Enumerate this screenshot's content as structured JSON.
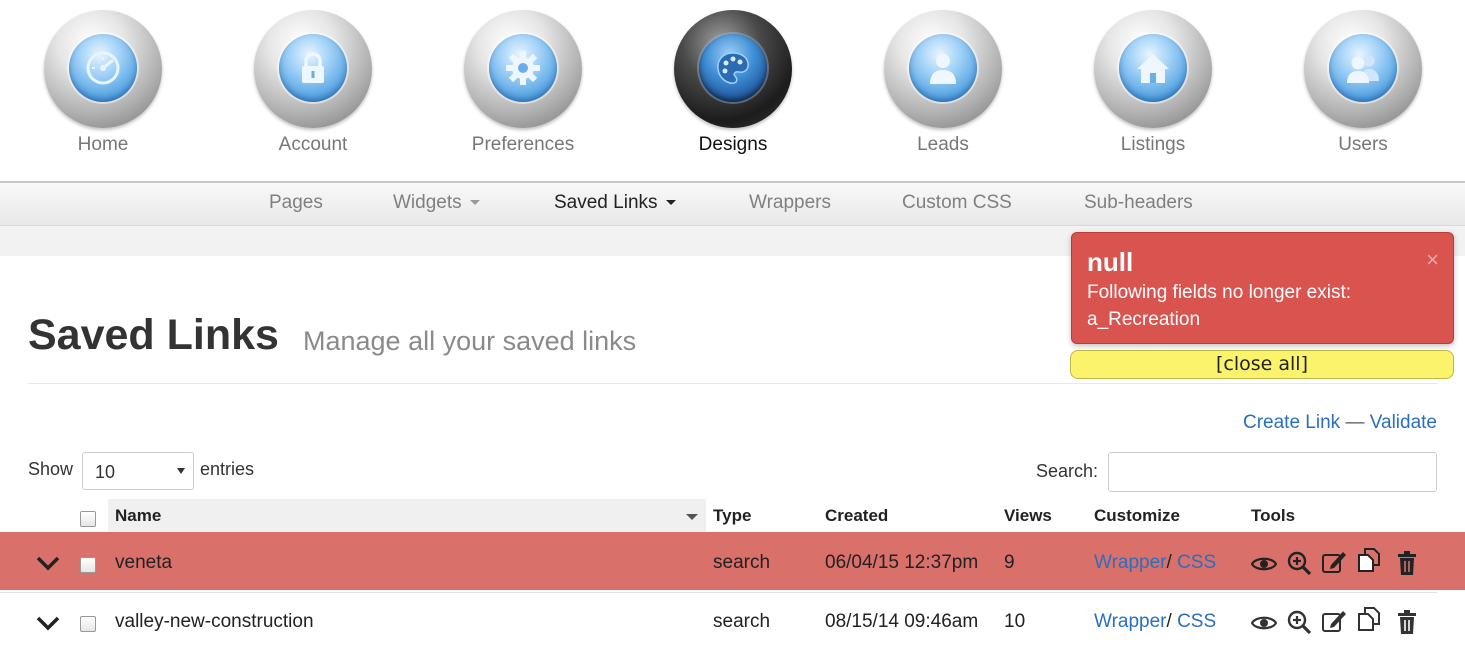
{
  "top_nav": {
    "items": [
      {
        "label": "Home",
        "icon": "dashboard-icon"
      },
      {
        "label": "Account",
        "icon": "lock-icon"
      },
      {
        "label": "Preferences",
        "icon": "gear-icon"
      },
      {
        "label": "Designs",
        "icon": "palette-icon",
        "active": true
      },
      {
        "label": "Leads",
        "icon": "person-icon"
      },
      {
        "label": "Listings",
        "icon": "house-icon"
      },
      {
        "label": "Users",
        "icon": "users-icon"
      }
    ]
  },
  "sub_nav": {
    "items": [
      {
        "label": "Pages"
      },
      {
        "label": "Widgets",
        "dropdown": true
      },
      {
        "label": "Saved Links",
        "dropdown": true,
        "active": true
      },
      {
        "label": "Wrappers"
      },
      {
        "label": "Custom CSS"
      },
      {
        "label": "Sub-headers"
      }
    ]
  },
  "page": {
    "title": "Saved Links",
    "subtitle": "Manage all your saved links",
    "create_link": "Create Link",
    "separator": "—",
    "validate": "Validate"
  },
  "table_controls": {
    "show_label": "Show",
    "entries_value": "10",
    "entries_label": "entries",
    "search_label": "Search:",
    "search_value": ""
  },
  "table": {
    "columns": [
      "Name",
      "Type",
      "Created",
      "Views",
      "Customize",
      "Tools"
    ],
    "rows": [
      {
        "name": "veneta",
        "type": "search",
        "created": "06/04/15 12:37pm",
        "views": "9",
        "wrapper": "Wrapper",
        "css": "CSS",
        "highlighted": true
      },
      {
        "name": "valley-new-construction",
        "type": "search",
        "created": "08/15/14 09:46am",
        "views": "10",
        "wrapper": "Wrapper",
        "css": "CSS",
        "highlighted": false
      }
    ]
  },
  "notification": {
    "title": "null",
    "message_line1": "Following fields no longer exist:",
    "message_line2": "a_Recreation",
    "close_symbol": "×",
    "close_all": "[close all]"
  },
  "colors": {
    "highlight_row": "#d9706a",
    "toast_bg": "#d9534f",
    "close_all_bg": "#fbf36b",
    "link": "#2a6fbf"
  }
}
